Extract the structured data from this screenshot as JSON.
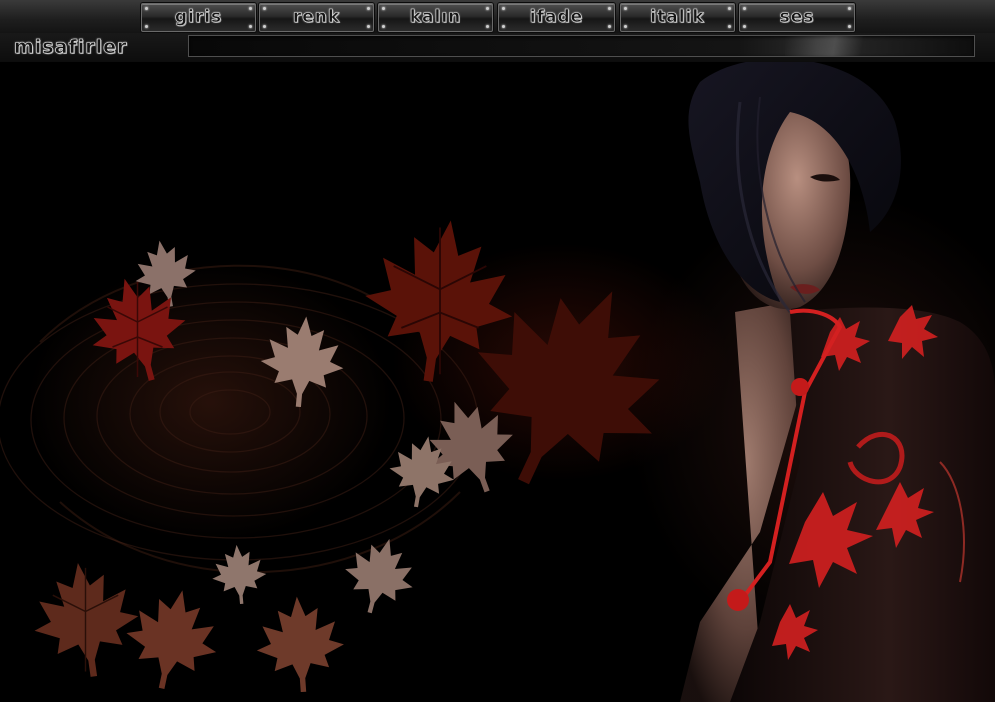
{
  "menu": {
    "items": [
      {
        "key": "giris",
        "label": "giris"
      },
      {
        "key": "renk",
        "label": "renk"
      },
      {
        "key": "kalin",
        "label": "kalın"
      },
      {
        "key": "ifade",
        "label": "ifade"
      },
      {
        "key": "italik",
        "label": "italik"
      },
      {
        "key": "ses",
        "label": "ses"
      }
    ]
  },
  "guestbook": {
    "label": "misafirler",
    "input_value": ""
  },
  "artwork": {
    "description_icons": [
      "maple-leaf-icon",
      "swirl-pattern",
      "woman-portrait"
    ],
    "colors": {
      "leaf_red": "#7a1410",
      "leaf_brown": "#5e2a1c",
      "leaf_pale": "#9a7c70",
      "dress_red": "#d32020"
    }
  }
}
